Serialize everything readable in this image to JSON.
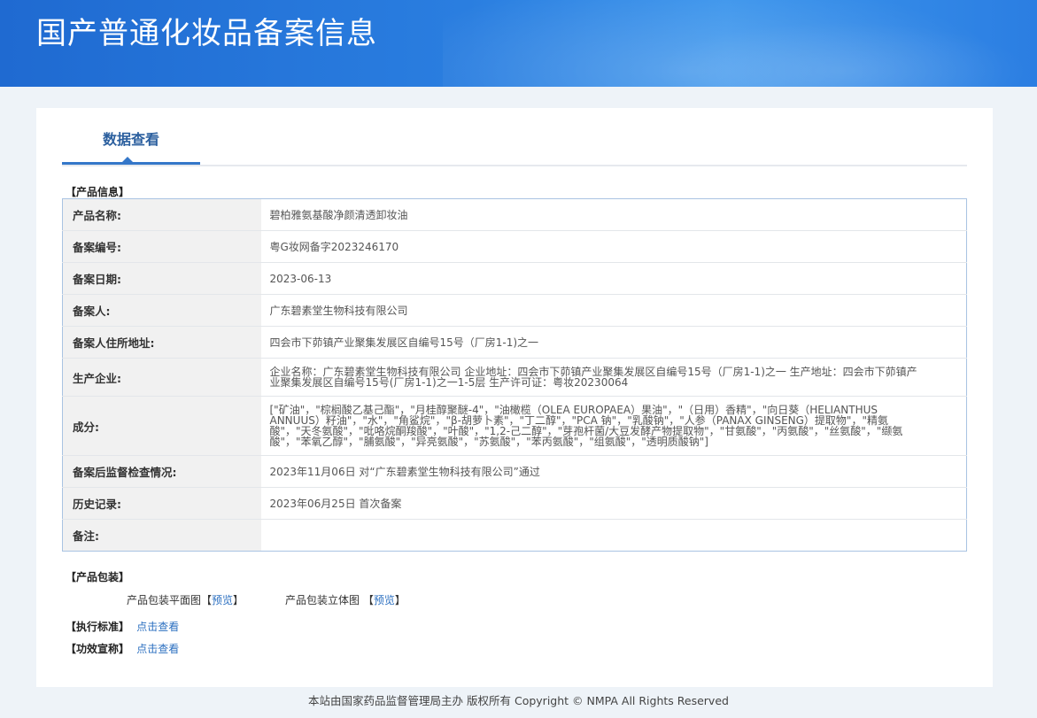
{
  "header": {
    "title": "国产普通化妆品备案信息"
  },
  "tabs": {
    "active_label": "数据查看"
  },
  "product_info": {
    "section_title": "【产品信息】",
    "rows": [
      {
        "label": "产品名称:",
        "value": "碧柏雅氨基酸净颜清透卸妆油"
      },
      {
        "label": "备案编号:",
        "value": "粤G妆网备字2023246170"
      },
      {
        "label": "备案日期:",
        "value": "2023-06-13"
      },
      {
        "label": "备案人:",
        "value": "广东碧素堂生物科技有限公司"
      },
      {
        "label": "备案人住所地址:",
        "value": "四会市下茆镇产业聚集发展区自编号15号（厂房1-1)之一"
      },
      {
        "label": "生产企业:",
        "value": "企业名称：广东碧素堂生物科技有限公司 企业地址：四会市下茆镇产业聚集发展区自编号15号（厂房1-1)之一 生产地址：四会市下茆镇产业聚集发展区自编号15号(厂房1-1)之一1-5层 生产许可证：粤妆20230064"
      },
      {
        "label": "成分:",
        "value": "[\"矿油\"，\"棕榈酸乙基己酯\"，\"月桂醇聚醚-4\"，\"油橄榄（OLEA EUROPAEA）果油\"，\"（日用）香精\"，\"向日葵（HELIANTHUS ANNUUS）籽油\"，\"水\"，\"角鲨烷\"，\"β-胡萝卜素\"，\"丁二醇\"，\"PCA 钠\"，\"乳酸钠\"，\"人参（PANAX GINSENG）提取物\"，\"精氨酸\"，\"天冬氨酸\"，\"吡咯烷酮羧酸\"，\"叶酸\"，\"1,2-己二醇\"，\"芽孢杆菌/大豆发酵产物提取物\"，\"甘氨酸\"，\"丙氨酸\"，\"丝氨酸\"，\"缬氨酸\"，\"苯氧乙醇\"，\"脯氨酸\"，\"异亮氨酸\"，\"苏氨酸\"，\"苯丙氨酸\"，\"组氨酸\"，\"透明质酸钠\"]"
      },
      {
        "label": "备案后监督检查情况:",
        "value": "2023年11月06日 对“广东碧素堂生物科技有限公司”通过"
      },
      {
        "label": "历史记录:",
        "value": "2023年06月25日 首次备案"
      },
      {
        "label": "备注:",
        "value": ""
      }
    ]
  },
  "packaging": {
    "section_title": "【产品包装】",
    "flat_label": "产品包装平面图【",
    "flat_link": "预览",
    "flat_close": "】",
    "solid_label": "产品包装立体图 【",
    "solid_link": "预览",
    "solid_close": "】"
  },
  "standard": {
    "section_title": "【执行标准】",
    "link": "点击查看"
  },
  "efficacy": {
    "section_title": "【功效宣称】",
    "link": "点击查看"
  },
  "footer": {
    "text": "本站由国家药品监督管理局主办 版权所有 Copyright © NMPA All Rights Reserved"
  }
}
